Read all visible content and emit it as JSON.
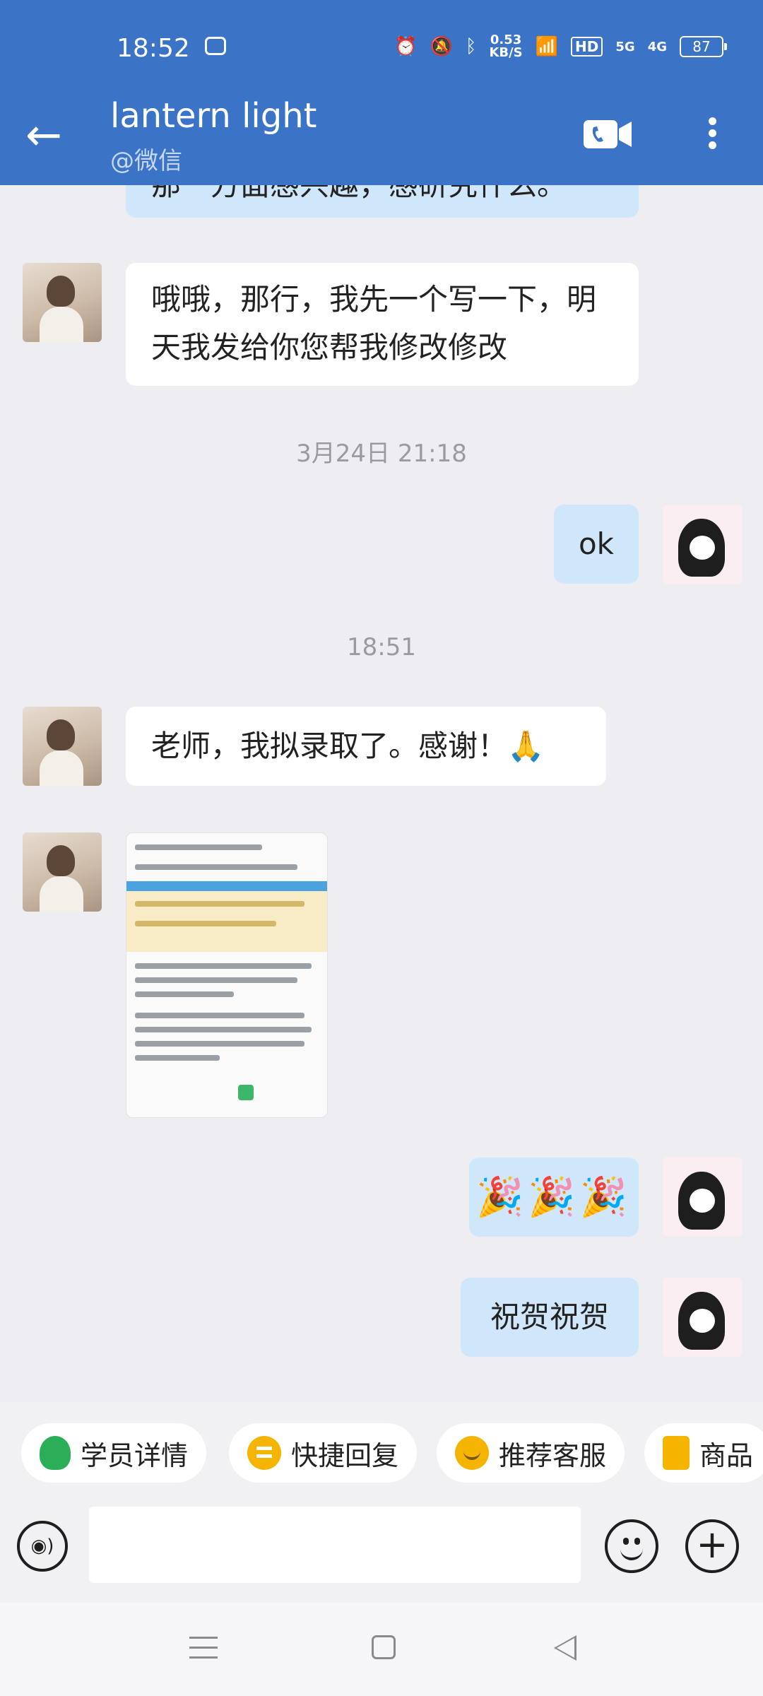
{
  "status_bar": {
    "time": "18:52",
    "net_speed": "0.53",
    "net_unit": "KB/S",
    "hd": "HD",
    "sig1": "5G",
    "sig2": "4G",
    "battery": "87"
  },
  "header": {
    "title": "lantern light",
    "subtitle": "@微信"
  },
  "messages": {
    "m0": "那一方面感兴趣，感研究什么。",
    "m1": "哦哦，那行，我先一个写一下，明天我发给你您帮我修改修改",
    "ts1": "3月24日  21:18",
    "m2": "ok",
    "ts2": "18:51",
    "m3": "老师，我拟录取了。感谢！🙏",
    "m4": "🎉🎉🎉",
    "m5": "祝贺祝贺"
  },
  "quick_actions": {
    "student_detail": "学员详情",
    "quick_reply": "快捷回复",
    "recommend_service": "推荐客服",
    "goods": "商品"
  },
  "colors": {
    "header_bg": "#3b73c6",
    "incoming_bubble": "#ffffff",
    "outgoing_bubble": "#cfe6fb"
  }
}
